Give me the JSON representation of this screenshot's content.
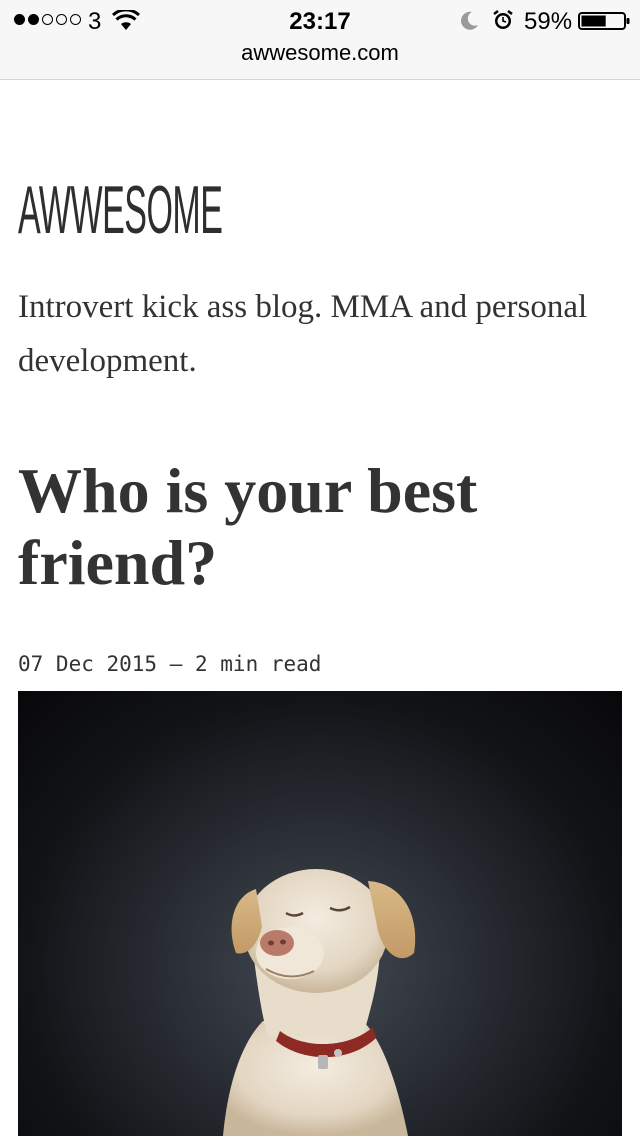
{
  "status_bar": {
    "carrier": "3",
    "time": "23:17",
    "battery_percent": "59%",
    "battery_level": 0.59,
    "signal_bars_filled": 2,
    "signal_bars_total": 5
  },
  "browser": {
    "url": "awwesome.com"
  },
  "site": {
    "logo_text": "AWWESOME",
    "tagline": "Introvert kick ass blog. MMA and personal development."
  },
  "post": {
    "title": "Who is your best friend?",
    "meta": "07 Dec 2015 – 2 min read",
    "image_subject": "dog-photo"
  },
  "icons": {
    "wifi": "wifi-icon",
    "moon": "moon-icon",
    "alarm": "alarm-icon",
    "battery": "battery-icon"
  }
}
